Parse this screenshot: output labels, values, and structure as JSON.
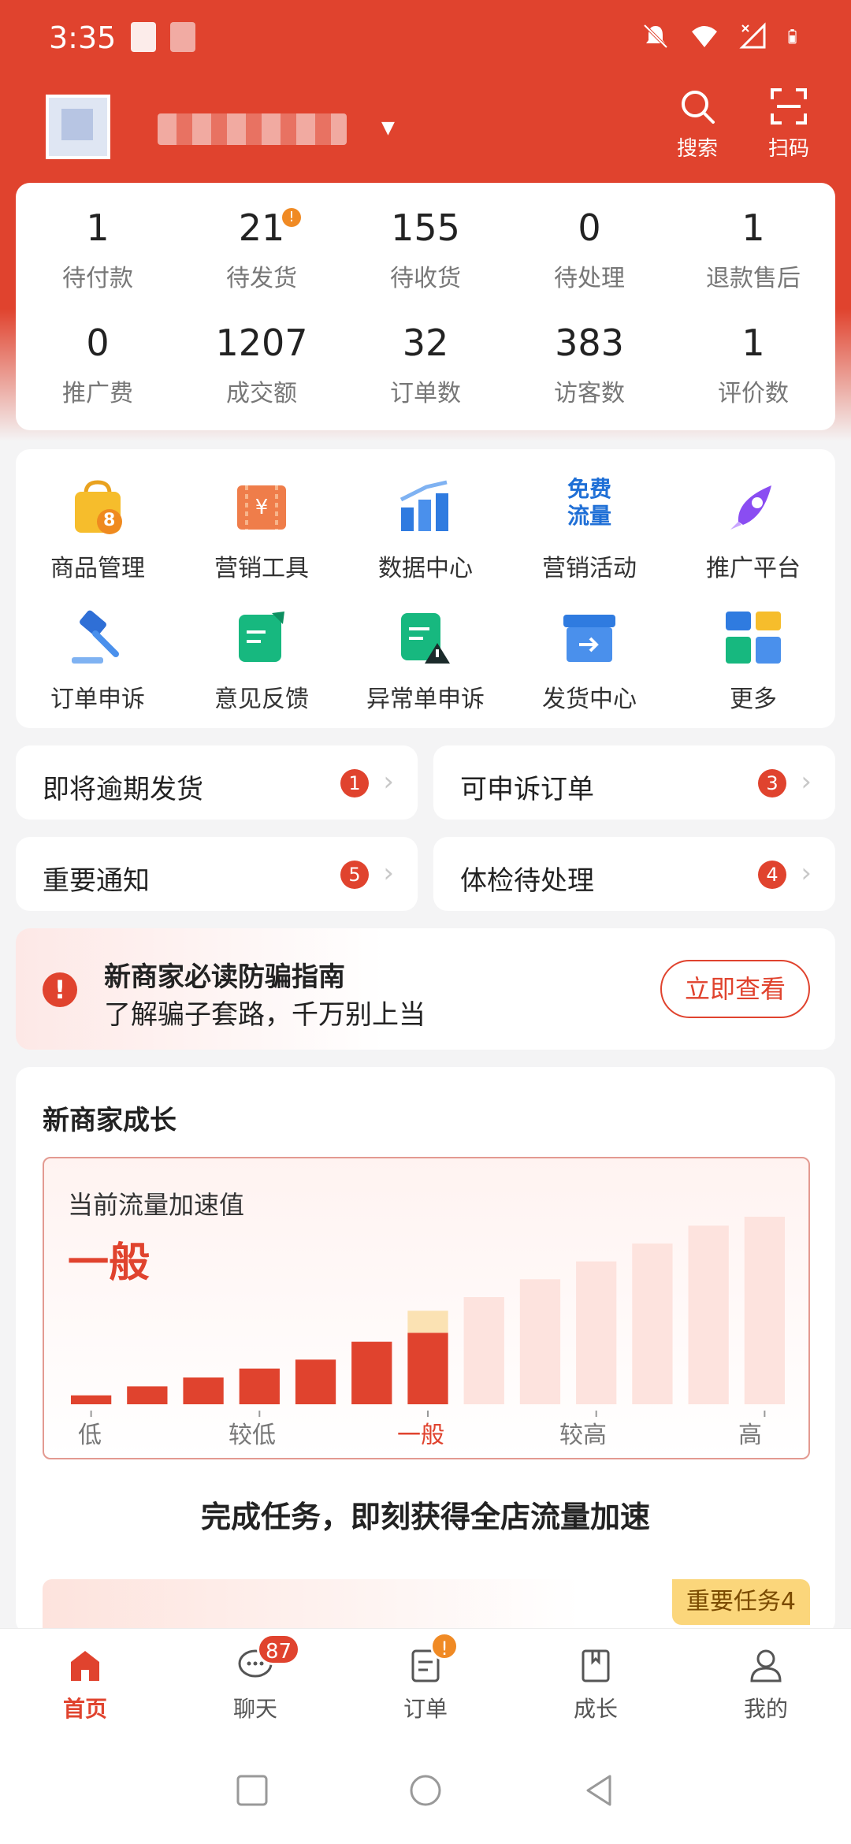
{
  "status_bar": {
    "time": "3:35"
  },
  "header": {
    "actions": [
      {
        "name": "search",
        "label": "搜索"
      },
      {
        "name": "scan",
        "label": "扫码"
      }
    ]
  },
  "stats": {
    "row1": [
      {
        "value": "1",
        "label": "待付款"
      },
      {
        "value": "21",
        "label": "待发货",
        "badge": "!"
      },
      {
        "value": "155",
        "label": "待收货"
      },
      {
        "value": "0",
        "label": "待处理"
      },
      {
        "value": "1",
        "label": "退款售后"
      }
    ],
    "row2": [
      {
        "value": "0",
        "label": "推广费"
      },
      {
        "value": "1207",
        "label": "成交额"
      },
      {
        "value": "32",
        "label": "订单数"
      },
      {
        "value": "383",
        "label": "访客数"
      },
      {
        "value": "1",
        "label": "评价数"
      }
    ]
  },
  "functions": {
    "row1": [
      {
        "label": "商品管理",
        "icon": "shopping-bag-icon",
        "badge": "8"
      },
      {
        "label": "营销工具",
        "icon": "coupon-icon"
      },
      {
        "label": "数据中心",
        "icon": "bar-chart-icon"
      },
      {
        "label": "营销活动",
        "icon": "free-traffic-icon",
        "icon_text": [
          "免费",
          "流量"
        ]
      },
      {
        "label": "推广平台",
        "icon": "rocket-icon"
      }
    ],
    "row2": [
      {
        "label": "订单申诉",
        "icon": "gavel-icon"
      },
      {
        "label": "意见反馈",
        "icon": "feedback-icon"
      },
      {
        "label": "异常单申诉",
        "icon": "warning-doc-icon"
      },
      {
        "label": "发货中心",
        "icon": "shipping-box-icon"
      },
      {
        "label": "更多",
        "icon": "more-icon"
      }
    ]
  },
  "todos": [
    {
      "label": "即将逾期发货",
      "count": "1"
    },
    {
      "label": "可申诉订单",
      "count": "3"
    },
    {
      "label": "重要通知",
      "count": "5"
    },
    {
      "label": "体检待处理",
      "count": "4"
    }
  ],
  "guide": {
    "title": "新商家必读防骗指南",
    "subtitle": "了解骗子套路，千万别上当",
    "button": "立即查看"
  },
  "growth": {
    "title": "新商家成长",
    "chart_label": "当前流量加速值",
    "current_level": "一般",
    "cta": "完成任务，即刻获得全店流量加速",
    "task_tag": "重要任务4"
  },
  "chart_data": {
    "type": "bar",
    "categories": [
      "1",
      "2",
      "3",
      "4",
      "5",
      "6",
      "7",
      "8",
      "9",
      "10",
      "11",
      "12",
      "13"
    ],
    "values": [
      1,
      2,
      3,
      4,
      5,
      7,
      8,
      12,
      14,
      16,
      18,
      20,
      21
    ],
    "active_count": 7,
    "current_index": 6,
    "tick_labels": [
      "低",
      "较低",
      "一般",
      "较高",
      "高"
    ],
    "tick_positions": [
      0,
      3,
      6,
      9,
      12
    ],
    "ylim": [
      0,
      24
    ],
    "colors": {
      "active": "#e0432e",
      "inactive": "#fde3de",
      "highlight": "#fbe2b3"
    }
  },
  "bottom_nav": [
    {
      "label": "首页",
      "icon": "home-icon",
      "active": true
    },
    {
      "label": "聊天",
      "icon": "chat-icon",
      "badge": "87"
    },
    {
      "label": "订单",
      "icon": "order-icon",
      "dot": "!"
    },
    {
      "label": "成长",
      "icon": "growth-book-icon"
    },
    {
      "label": "我的",
      "icon": "user-icon"
    }
  ],
  "theme": {
    "primary": "#e0432e",
    "accent_orange": "#f08a24"
  }
}
